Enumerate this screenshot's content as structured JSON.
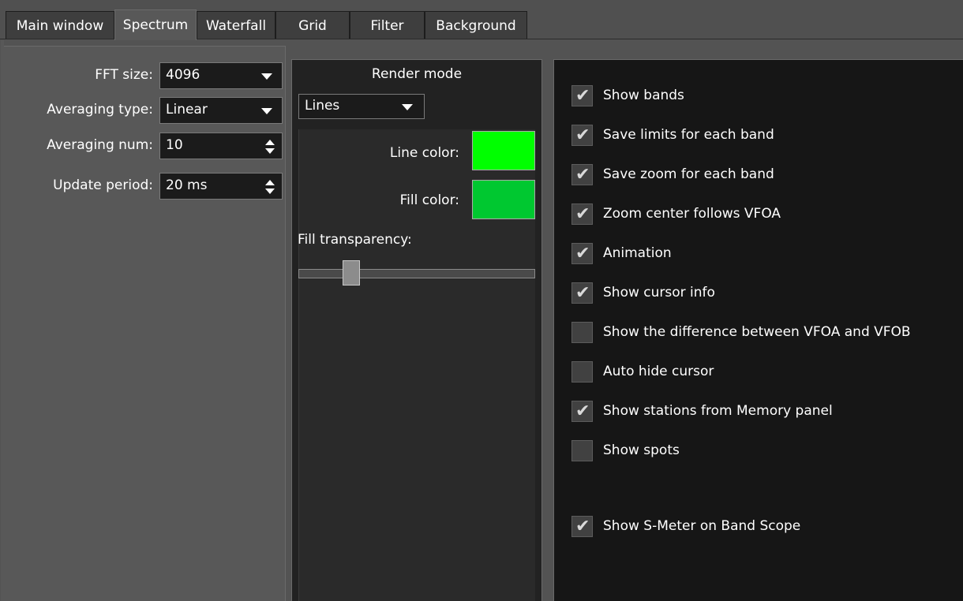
{
  "tabs": [
    {
      "label": "Main window",
      "active": false
    },
    {
      "label": "Spectrum",
      "active": true
    },
    {
      "label": "Waterfall",
      "active": false
    },
    {
      "label": "Grid",
      "active": false
    },
    {
      "label": "Filter",
      "active": false
    },
    {
      "label": "Background",
      "active": false
    }
  ],
  "settings": {
    "fft_size": {
      "label": "FFT size:",
      "value": "4096"
    },
    "averaging_type": {
      "label": "Averaging type:",
      "value": "Linear"
    },
    "averaging_num": {
      "label": "Averaging num:",
      "value": "10"
    },
    "update_period": {
      "label": "Update period:",
      "value": "20 ms"
    }
  },
  "render": {
    "title": "Render mode",
    "mode": "Lines",
    "line_color_label": "Line color:",
    "line_color": "#00ff00",
    "fill_color_label": "Fill color:",
    "fill_color": "#00c830",
    "fill_transparency_label": "Fill transparency:",
    "fill_transparency": 0.2
  },
  "checks": [
    {
      "label": "Show bands",
      "checked": true
    },
    {
      "label": "Save limits for each band",
      "checked": true
    },
    {
      "label": "Save zoom for each band",
      "checked": true
    },
    {
      "label": "Zoom center follows VFOA",
      "checked": true
    },
    {
      "label": "Animation",
      "checked": true
    },
    {
      "label": "Show cursor info",
      "checked": true
    },
    {
      "label": "Show the difference between VFOA and VFOB",
      "checked": false
    },
    {
      "label": "Auto hide cursor",
      "checked": false
    },
    {
      "label": "Show stations from Memory panel",
      "checked": true
    },
    {
      "label": "Show spots",
      "checked": false
    },
    {
      "label": "Show S-Meter on Band Scope",
      "checked": true
    }
  ]
}
